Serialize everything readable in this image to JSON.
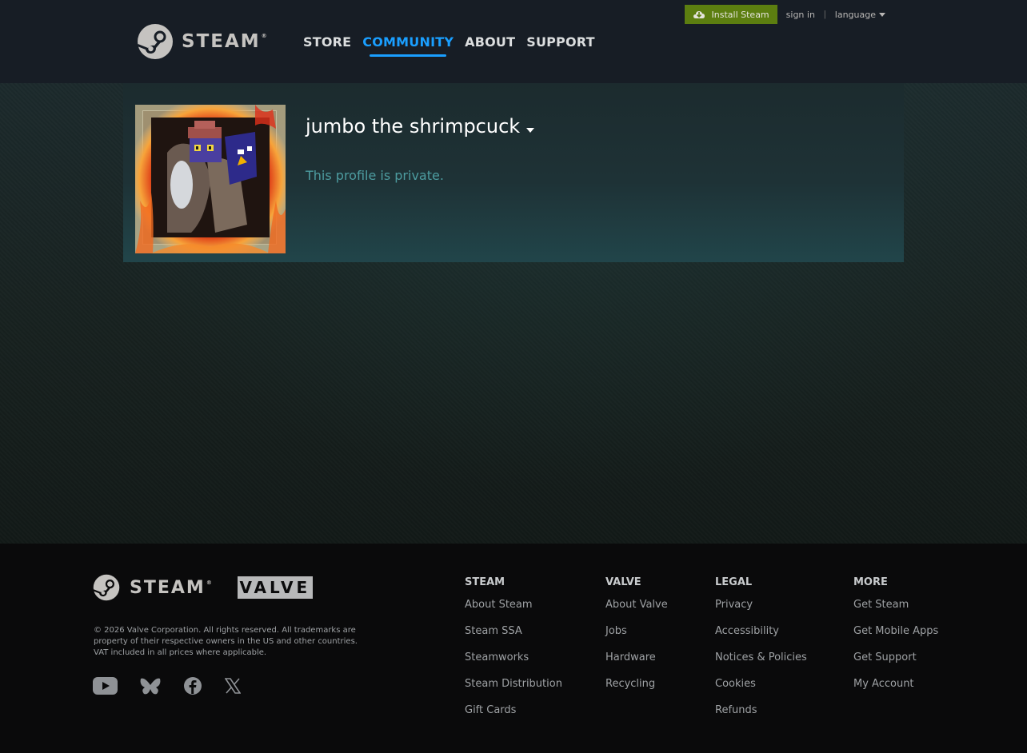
{
  "header": {
    "logo_text": "STEAM",
    "nav": [
      {
        "label": "STORE",
        "active": false
      },
      {
        "label": "COMMUNITY",
        "active": true
      },
      {
        "label": "ABOUT",
        "active": false
      },
      {
        "label": "SUPPORT",
        "active": false
      }
    ],
    "install_label": "Install Steam",
    "sign_in_label": "sign in",
    "separator": "|",
    "language_label": "language"
  },
  "profile": {
    "persona_name": "jumbo the shrimpcuck",
    "private_message": "This profile is private."
  },
  "footer": {
    "steam_logo_text": "STEAM",
    "valve_logo_text": "VALVE",
    "copyright": "© 2026 Valve Corporation. All rights reserved. All trademarks are property of their respective owners in the US and other countries. VAT included in all prices where applicable.",
    "social_icons": [
      "youtube-icon",
      "bluesky-icon",
      "facebook-icon",
      "x-icon"
    ],
    "columns": [
      {
        "heading": "STEAM",
        "links": [
          "About Steam",
          "Steam SSA",
          "Steamworks",
          "Steam Distribution",
          "Gift Cards"
        ]
      },
      {
        "heading": "VALVE",
        "links": [
          "About Valve",
          "Jobs",
          "Hardware",
          "Recycling"
        ]
      },
      {
        "heading": "LEGAL",
        "links": [
          "Privacy",
          "Accessibility",
          "Notices & Policies",
          "Cookies",
          "Refunds"
        ]
      },
      {
        "heading": "MORE",
        "links": [
          "Get Steam",
          "Get Mobile Apps",
          "Get Support",
          "My Account"
        ]
      }
    ]
  },
  "colors": {
    "header_bg": "#171d25",
    "accent_blue": "#1a9fff",
    "install_green": "#5c7e10",
    "private_teal": "#4d9ca0",
    "footer_bg": "#0a0a0b"
  }
}
